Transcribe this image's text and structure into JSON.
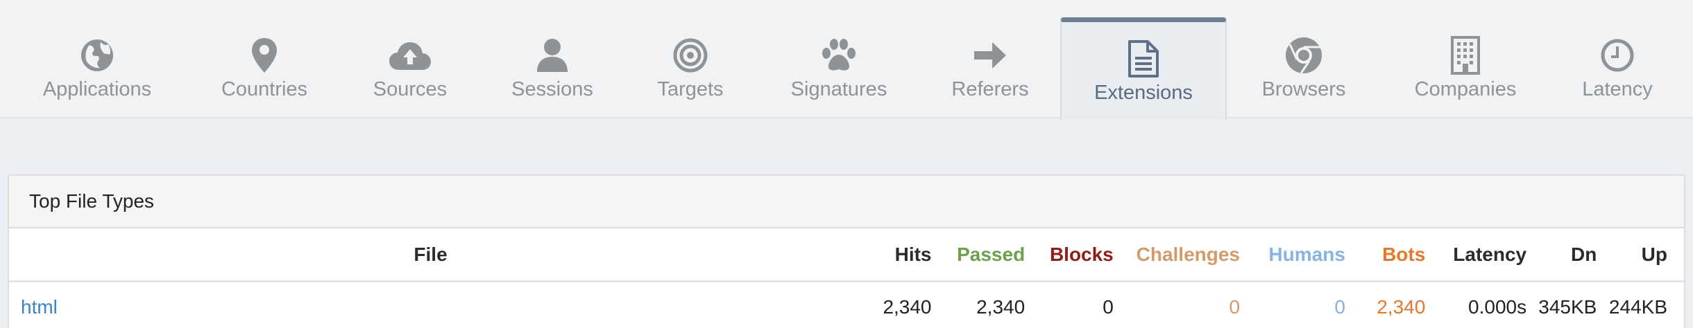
{
  "tabs": [
    {
      "label": "Applications",
      "icon": "globe-icon"
    },
    {
      "label": "Countries",
      "icon": "map-pin-icon"
    },
    {
      "label": "Sources",
      "icon": "cloud-upload-icon"
    },
    {
      "label": "Sessions",
      "icon": "user-icon"
    },
    {
      "label": "Targets",
      "icon": "target-icon"
    },
    {
      "label": "Signatures",
      "icon": "paw-icon"
    },
    {
      "label": "Referers",
      "icon": "arrow-right-icon"
    },
    {
      "label": "Extensions",
      "icon": "file-text-icon",
      "active": true
    },
    {
      "label": "Browsers",
      "icon": "chrome-icon"
    },
    {
      "label": "Companies",
      "icon": "building-icon"
    },
    {
      "label": "Latency",
      "icon": "clock-icon"
    }
  ],
  "panel": {
    "title": "Top File Types",
    "columns": {
      "file": "File",
      "hits": "Hits",
      "passed": "Passed",
      "blocks": "Blocks",
      "challenges": "Challenges",
      "humans": "Humans",
      "bots": "Bots",
      "latency": "Latency",
      "dn": "Dn",
      "up": "Up"
    },
    "rows": [
      {
        "file": "html",
        "hits": "2,340",
        "passed": "2,340",
        "blocks": "0",
        "challenges": "0",
        "humans": "0",
        "bots": "2,340",
        "latency": "0.000s",
        "dn": "345KB",
        "up": "244KB"
      }
    ]
  },
  "colors": {
    "tab_text": "#8f9297",
    "active_tab_text": "#5a6b80",
    "active_tab_accent": "#6e7f93",
    "passed": "#6aa14a",
    "blocks": "#8e1c17",
    "challenges": "#d29b6b",
    "humans": "#86b3e0",
    "bots": "#e4782d",
    "link": "#3b83c4"
  }
}
